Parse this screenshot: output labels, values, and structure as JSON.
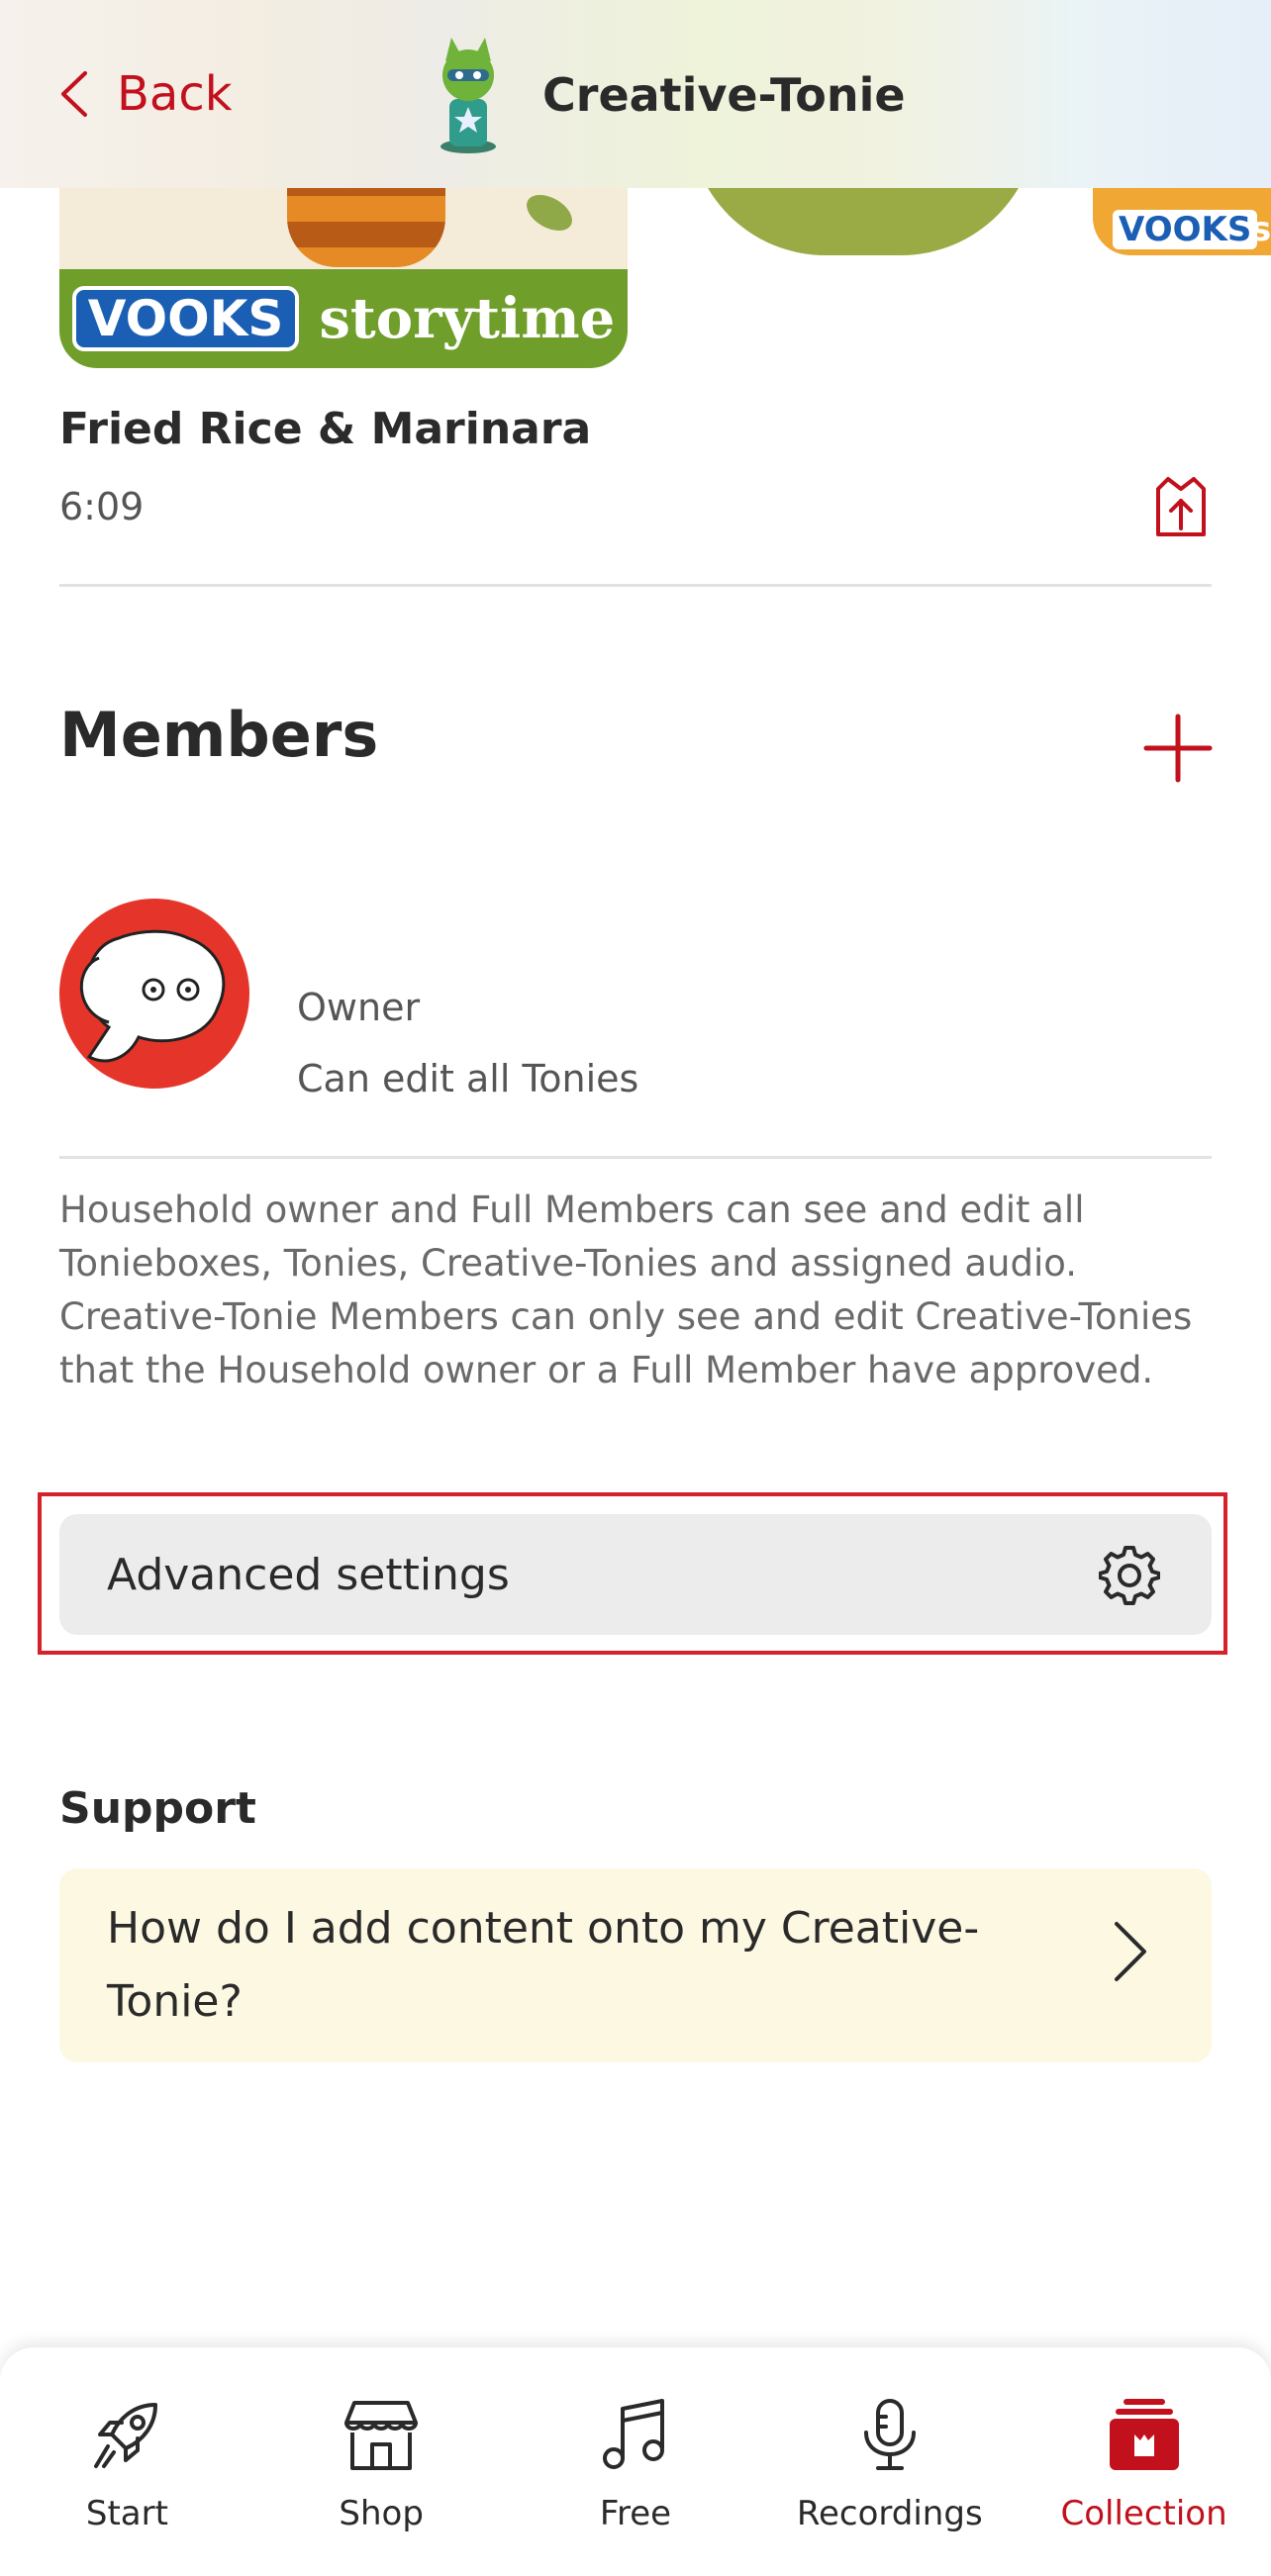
{
  "header": {
    "back_label": "Back",
    "title": "Creative-Tonie"
  },
  "carousel": {
    "card1_brand": "VOOKS",
    "card1_series": "storytime",
    "card3_brand": "VOOKS",
    "card3_series": "sto"
  },
  "track": {
    "title": "Fried Rice & Marinara",
    "duration": "6:09"
  },
  "members": {
    "heading": "Members",
    "items": [
      {
        "role": "Owner",
        "permission": "Can edit all Tonies"
      }
    ],
    "info": "Household owner and Full Members can see and edit all Tonieboxes, Tonies, Creative-Tonies and assigned audio. Creative-Tonie Members can only see and edit Creative-Tonies that the Household owner or a Full Member have approved."
  },
  "advanced": {
    "label": "Advanced settings"
  },
  "support": {
    "heading": "Support",
    "faq": "How do I add content onto my Creative-Tonie?"
  },
  "nav": {
    "items": [
      {
        "label": "Start",
        "icon": "rocket-icon"
      },
      {
        "label": "Shop",
        "icon": "shop-icon"
      },
      {
        "label": "Free",
        "icon": "music-note-icon"
      },
      {
        "label": "Recordings",
        "icon": "microphone-icon"
      },
      {
        "label": "Collection",
        "icon": "collection-icon",
        "active": true
      }
    ]
  },
  "colors": {
    "accent": "#c2101c",
    "faq_background": "#fdf8e2",
    "button_background": "#ececec"
  }
}
